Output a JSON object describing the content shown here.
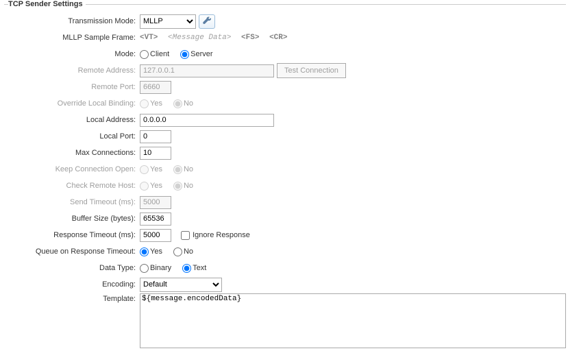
{
  "group": {
    "legend": "TCP Sender Settings"
  },
  "labels": {
    "transmissionMode": "Transmission Mode:",
    "sampleFrame": "MLLP Sample Frame:",
    "mode": "Mode:",
    "remoteAddress": "Remote Address:",
    "remotePort": "Remote Port:",
    "overrideLocalBinding": "Override Local Binding:",
    "localAddress": "Local Address:",
    "localPort": "Local Port:",
    "maxConnections": "Max Connections:",
    "keepConnectionOpen": "Keep Connection Open:",
    "checkRemoteHost": "Check Remote Host:",
    "sendTimeout": "Send Timeout (ms):",
    "bufferSize": "Buffer Size (bytes):",
    "responseTimeout": "Response Timeout (ms):",
    "queueOnResponseTimeout": "Queue on Response Timeout:",
    "dataType": "Data Type:",
    "encoding": "Encoding:",
    "template": "Template:"
  },
  "transmissionMode": {
    "value": "MLLP"
  },
  "sampleFrame": {
    "vt": "<VT>",
    "msg": "<Message Data>",
    "fs": "<FS>",
    "cr": "<CR>"
  },
  "mode": {
    "client": "Client",
    "server": "Server",
    "value": "Server"
  },
  "remoteAddress": {
    "value": "127.0.0.1",
    "testBtn": "Test Connection"
  },
  "remotePort": {
    "value": "6660"
  },
  "overrideLocalBinding": {
    "yes": "Yes",
    "no": "No",
    "value": "No"
  },
  "localAddress": {
    "value": "0.0.0.0"
  },
  "localPort": {
    "value": "0"
  },
  "maxConnections": {
    "value": "10"
  },
  "keepConnectionOpen": {
    "yes": "Yes",
    "no": "No",
    "value": "No"
  },
  "checkRemoteHost": {
    "yes": "Yes",
    "no": "No",
    "value": "No"
  },
  "sendTimeout": {
    "value": "5000"
  },
  "bufferSize": {
    "value": "65536"
  },
  "responseTimeout": {
    "value": "5000",
    "ignore": "Ignore Response",
    "ignoreChecked": false
  },
  "queueOnResponseTimeout": {
    "yes": "Yes",
    "no": "No",
    "value": "Yes"
  },
  "dataType": {
    "binary": "Binary",
    "text": "Text",
    "value": "Text"
  },
  "encoding": {
    "value": "Default"
  },
  "template": {
    "value": "${message.encodedData}"
  }
}
